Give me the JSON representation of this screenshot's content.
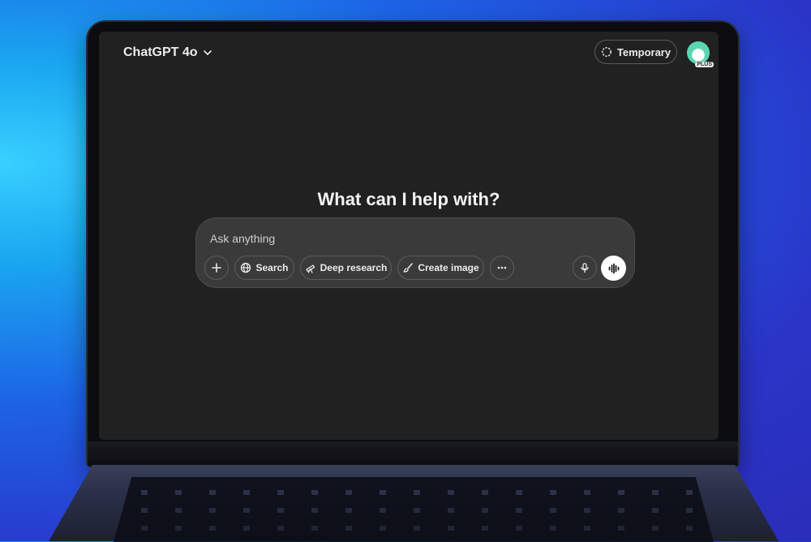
{
  "header": {
    "model_name": "ChatGPT 4o",
    "temporary_label": "Temporary",
    "plan_badge": "PLUS"
  },
  "main": {
    "headline": "What can I help with?"
  },
  "composer": {
    "placeholder": "Ask anything",
    "tools": {
      "search": "Search",
      "deep_research": "Deep research",
      "create_image": "Create image"
    }
  },
  "icons": [
    "chevron-down-icon",
    "temporary-chat-icon",
    "avatar",
    "plus-icon",
    "globe-icon",
    "telescope-icon",
    "brush-icon",
    "more-icon",
    "microphone-icon",
    "voice-wave-icon"
  ],
  "colors": {
    "screen_bg": "#212121",
    "composer_bg": "#3a3a3a",
    "text": "#ececec"
  }
}
